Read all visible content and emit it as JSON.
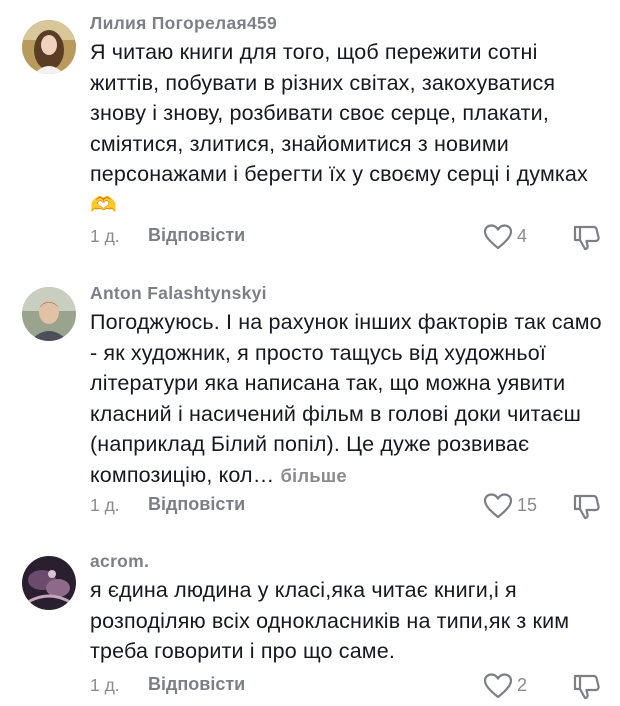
{
  "comments": [
    {
      "author": "Лилия Погорелая459",
      "text": "Я читаю книги для того, щоб пережити сотні життів, побувати в різних світах, закохуватися знову і знову, розбивати своє серце, плакати, сміятися, злитися, знайомитися з новими персонажами і берегти їх у своєму серці і думках🫶",
      "time": "1 д.",
      "reply_label": "Відповісти",
      "likes": "4"
    },
    {
      "author": "Anton Falashtynskyi",
      "text": "Погоджуюсь. І на рахунок інших факторів так само - як художник, я просто тащусь від художньої літератури яка написана так, що можна уявити класний і насичений фільм в голові доки читаєш (наприклад Білий попіл). Це дуже розвиває композицію, кол…",
      "more_label": "більше",
      "time": "1 д.",
      "reply_label": "Відповісти",
      "likes": "15"
    },
    {
      "author": "acrom.",
      "text": "я єдина людина у класі,яка читає книги,і я розподіляю всіх однокласників на типи,як з ким треба говорити і про що саме.",
      "time": "1 д.",
      "reply_label": "Відповісти",
      "likes": "2"
    }
  ],
  "icons": {
    "like": "heart-outline-icon",
    "dislike": "thumbs-down-outline-icon"
  },
  "colors": {
    "text": "#161823",
    "secondary": "#8a8b91",
    "author": "#7d7f86"
  }
}
